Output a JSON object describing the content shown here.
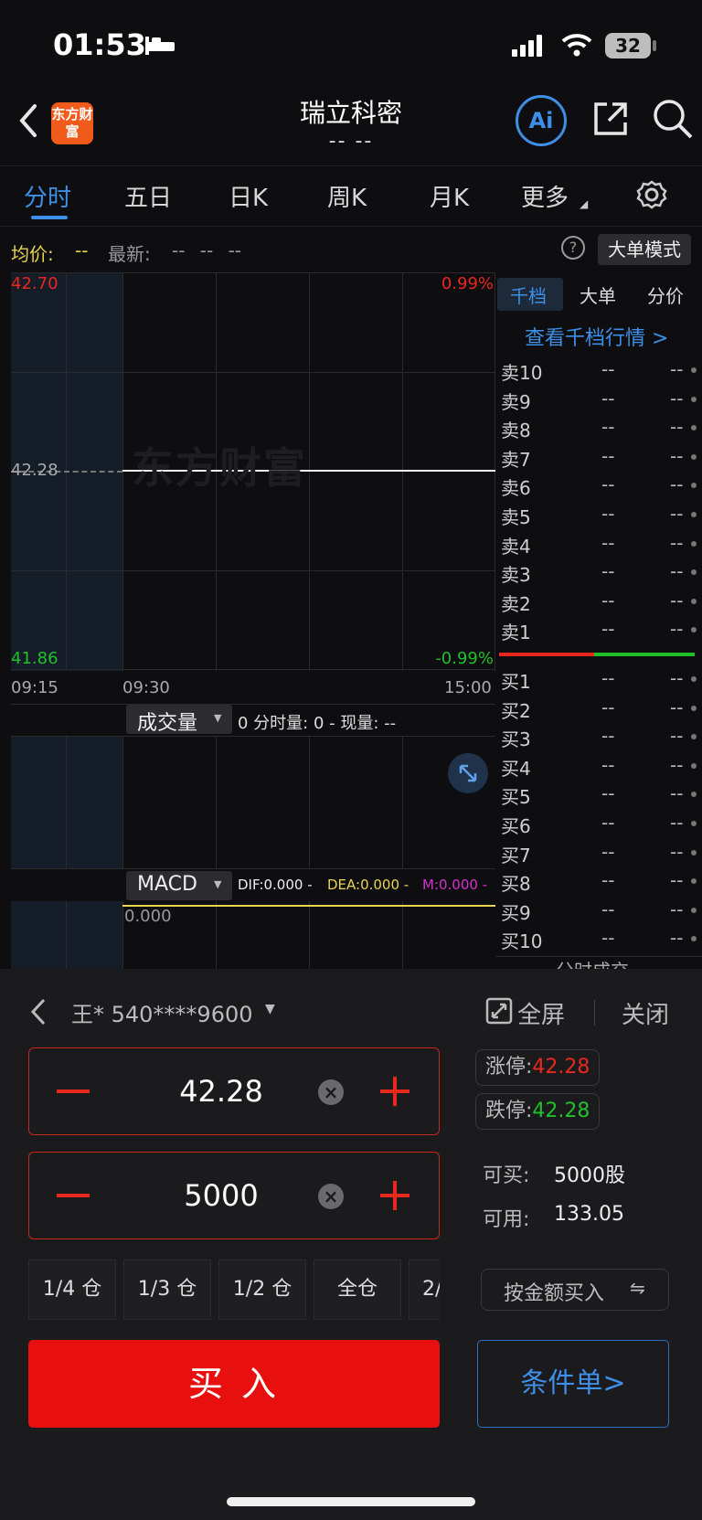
{
  "status": {
    "time": "01:53",
    "battery": "32"
  },
  "header": {
    "title": "瑞立科密",
    "subtitle": "-- --",
    "logo_text": "东方财富",
    "ai_label": "Ai"
  },
  "tabs": [
    "分时",
    "五日",
    "日K",
    "周K",
    "月K",
    "更多"
  ],
  "info": {
    "avg_label": "均价:",
    "avg_value": "--",
    "latest_label": "最新:",
    "latest_value": "-- -- --",
    "mode_button": "大单模式"
  },
  "chart": {
    "price_high": "42.70",
    "price_mid": "42.28",
    "price_low": "41.86",
    "pct_high": "0.99%",
    "pct_low": "-0.99%",
    "time_labels": [
      "09:15",
      "09:30",
      "15:00"
    ],
    "watermark": "东方财富",
    "volume": {
      "selector": "成交量",
      "readout": "0 分时量: 0 - 现量: --"
    },
    "macd": {
      "selector": "MACD",
      "dif": "DIF:0.000 -",
      "dea": "DEA:0.000 -",
      "m": "M:0.000 -",
      "zero": "0.000"
    }
  },
  "orderbook": {
    "tabs": [
      "千档",
      "大单",
      "分价"
    ],
    "view_all": "查看千档行情 >",
    "sells": [
      "卖10",
      "卖9",
      "卖8",
      "卖7",
      "卖6",
      "卖5",
      "卖4",
      "卖3",
      "卖2",
      "卖1"
    ],
    "buys": [
      "买1",
      "买2",
      "买3",
      "买4",
      "买5",
      "买6",
      "买7",
      "买8",
      "买9",
      "买10"
    ],
    "placeholder": "--",
    "footer": "分时成交"
  },
  "trade": {
    "account": "王* 540****9600",
    "fullscreen": "全屏",
    "close": "关闭",
    "price": "42.28",
    "quantity": "5000",
    "limit_up_label": "涨停:",
    "limit_up_value": "42.28",
    "limit_down_label": "跌停:",
    "limit_down_value": "42.28",
    "can_buy_label": "可买:",
    "can_buy_value": "5000股",
    "available_label": "可用:",
    "available_value": "133.05",
    "positions": [
      "1/4 仓",
      "1/3 仓",
      "1/2 仓",
      "全仓",
      "2/"
    ],
    "by_amount": "按金额买入",
    "buy_button": "买 入",
    "conditional": "条件单>"
  },
  "colors": {
    "accent": "#3d8fe8",
    "up": "#e8271e",
    "down": "#1fc12a",
    "avg": "#e8d44d",
    "macd_m": "#d42fd4"
  }
}
